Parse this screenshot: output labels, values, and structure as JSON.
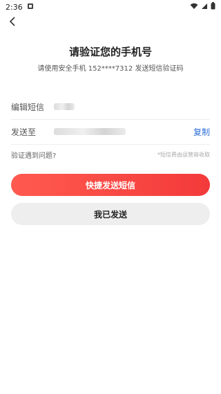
{
  "status_bar": {
    "time": "2:36"
  },
  "nav": {
    "back_icon": "chevron-left-icon"
  },
  "heading": {
    "title": "请验证您的手机号",
    "subtitle": "请使用安全手机 152****7312 发送短信验证码"
  },
  "sms_row": {
    "label": "编辑短信"
  },
  "send_row": {
    "label": "发送至",
    "copy_label": "复制"
  },
  "help": {
    "link": "验证遇到问题?",
    "note": "*短信费由运营商收取"
  },
  "buttons": {
    "quick_send": "快捷发送短信",
    "self_send": "我已发送"
  },
  "colors": {
    "accent": "#f33a3a",
    "link": "#2f6fd6"
  }
}
